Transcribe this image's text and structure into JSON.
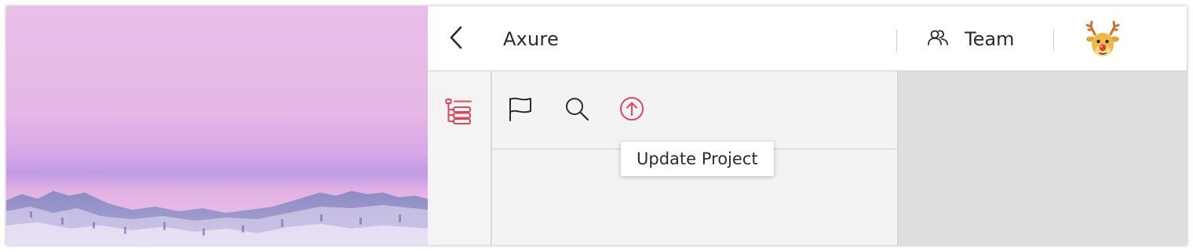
{
  "header": {
    "back_icon": "chevron-left-icon",
    "title": "Axure",
    "team": {
      "icon": "team-people-icon",
      "label": "Team"
    },
    "avatar_icon": "reindeer-avatar-icon"
  },
  "sidebar": {
    "items": [
      {
        "icon": "tree-list-icon",
        "active": true
      }
    ]
  },
  "toolbar": {
    "tools": [
      {
        "icon": "flag-icon"
      },
      {
        "icon": "search-icon"
      },
      {
        "icon": "update-arrow-up-icon",
        "tooltip": "Update Project"
      }
    ]
  },
  "colors": {
    "accent": "#e0475a",
    "text": "#2b2b2b",
    "panel_bg": "#f3f3f3",
    "canvas_bg": "#dedede",
    "divider": "#cfcfcf"
  }
}
